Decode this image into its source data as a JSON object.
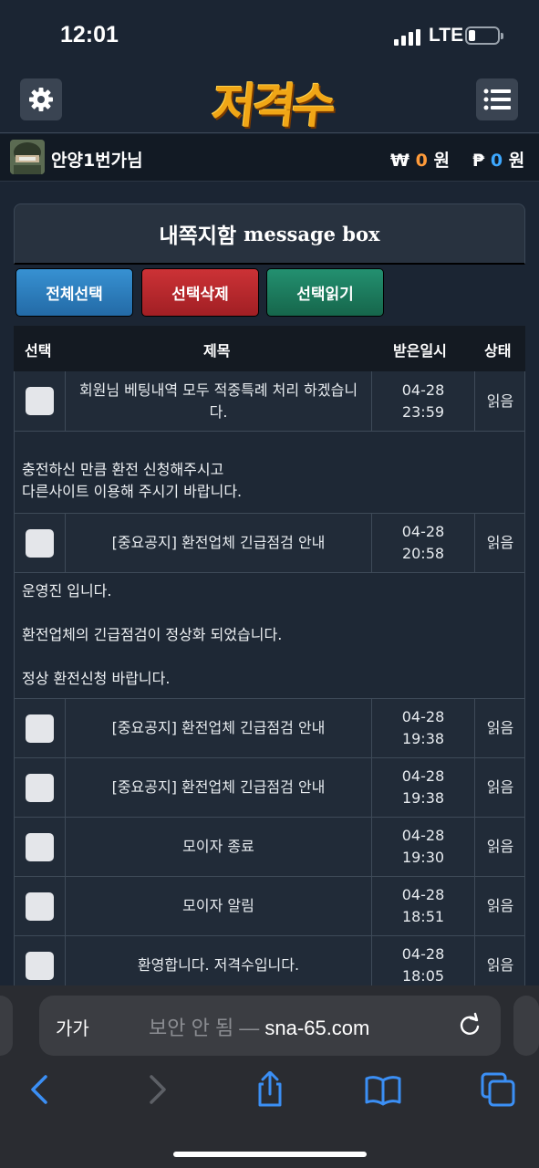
{
  "status_bar": {
    "time": "12:01",
    "network": "LTE"
  },
  "header": {
    "logo_text": "저격수"
  },
  "user": {
    "name": "안양1번가님",
    "won_symbol": "₩",
    "won_value": "0",
    "won_unit": "원",
    "point_symbol": "₱",
    "point_value": "0",
    "point_unit": "원"
  },
  "messagebox": {
    "title": "내쪽지함",
    "title_en": "message box"
  },
  "buttons": {
    "select_all": "전체선택",
    "delete_selected": "선택삭제",
    "read_selected": "선택읽기"
  },
  "table": {
    "headers": {
      "select": "선택",
      "title": "제목",
      "received": "받은일시",
      "status": "상태"
    },
    "rows": [
      {
        "title": "회원님 베팅내역 모두 적중특례 처리 하겠습니다.",
        "date": "04-28",
        "time": "23:59",
        "status": "읽음",
        "body": "충전하신 만큼 환전 신청해주시고\n다른사이트 이용해 주시기 바랍니다."
      },
      {
        "title": "[중요공지] 환전업체 긴급점검 안내",
        "date": "04-28",
        "time": "20:58",
        "status": "읽음",
        "body": "운영진 입니다.\n\n환전업체의 긴급점검이 정상화 되었습니다.\n\n정상 환전신청 바랍니다."
      },
      {
        "title": "[중요공지] 환전업체 긴급점검 안내",
        "date": "04-28",
        "time": "19:38",
        "status": "읽음"
      },
      {
        "title": "[중요공지] 환전업체 긴급점검 안내",
        "date": "04-28",
        "time": "19:38",
        "status": "읽음"
      },
      {
        "title": "모이자 종료",
        "date": "04-28",
        "time": "19:30",
        "status": "읽음"
      },
      {
        "title": "모이자 알림",
        "date": "04-28",
        "time": "18:51",
        "status": "읽음"
      },
      {
        "title": "환영합니다. 저격수입니다.",
        "date": "04-28",
        "time": "18:05",
        "status": "읽음"
      }
    ]
  },
  "browser": {
    "text_size": "가가",
    "url_prefix": "보안 안 됨 — ",
    "url_domain": "sna-65.com"
  },
  "colors": {
    "background": "#1b2533",
    "logo": "#f0a616",
    "btn_blue": "#2b7fc0",
    "btn_red": "#b8282c",
    "btn_green": "#1d7a5a",
    "won_orange": "#ff9b3a",
    "point_blue": "#3da8ff"
  }
}
